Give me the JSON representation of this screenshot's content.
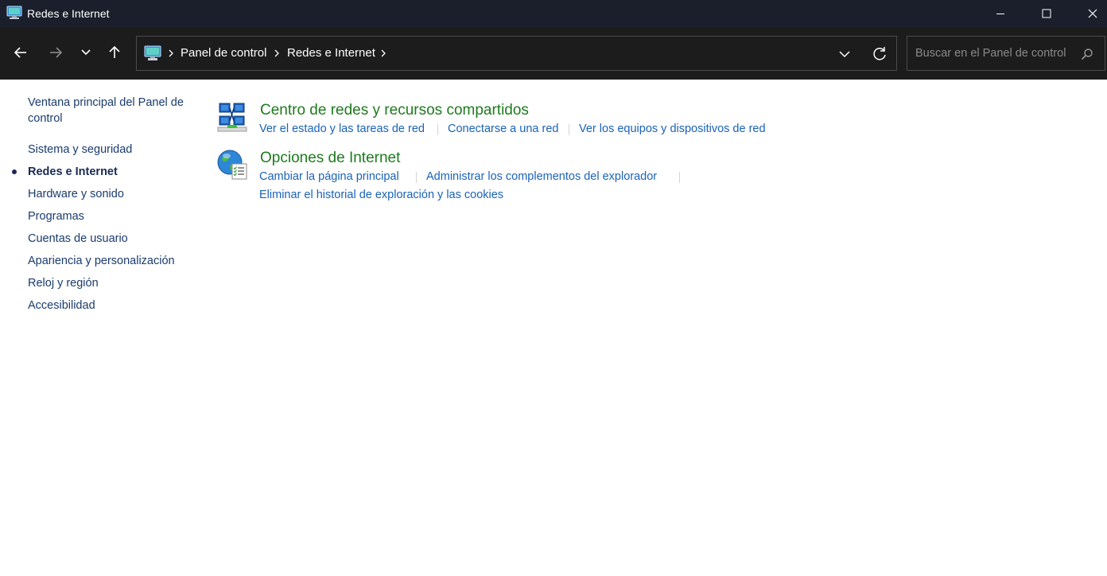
{
  "window": {
    "title": "Redes e Internet",
    "icons": [
      "control-panel-icon",
      "minimize-icon",
      "maximize-icon",
      "close-icon"
    ]
  },
  "navigation": {
    "icons": [
      "back-arrow-icon",
      "forward-arrow-icon",
      "chevron-down-icon",
      "up-arrow-icon"
    ]
  },
  "address": {
    "crumbs": [
      "Panel de control",
      "Redes e Internet"
    ],
    "icons": [
      "control-panel-icon",
      "chevron-right-icon",
      "chevron-down-icon",
      "refresh-icon"
    ]
  },
  "search": {
    "placeholder": "Buscar en el Panel de control",
    "icon": "search-icon"
  },
  "sidebar": {
    "home_link": "Ventana principal del Panel de control",
    "items": [
      {
        "label": "Sistema y seguridad",
        "active": false
      },
      {
        "label": "Redes e Internet",
        "active": true
      },
      {
        "label": "Hardware y sonido",
        "active": false
      },
      {
        "label": "Programas",
        "active": false
      },
      {
        "label": "Cuentas de usuario",
        "active": false
      },
      {
        "label": "Apariencia y personalización",
        "active": false
      },
      {
        "label": "Reloj y región",
        "active": false
      },
      {
        "label": "Accesibilidad",
        "active": false
      }
    ]
  },
  "categories": [
    {
      "title": "Centro de redes y recursos compartidos",
      "icon": "network-center-icon",
      "links": [
        "Ver el estado y las tareas de red",
        "Conectarse a una red",
        "Ver los equipos y dispositivos de red"
      ]
    },
    {
      "title": "Opciones de Internet",
      "icon": "internet-options-icon",
      "links": [
        "Cambiar la página principal",
        "Administrar los complementos del explorador",
        "Eliminar el historial de exploración y las cookies"
      ]
    }
  ],
  "colors": {
    "titlebar": "#1a1f2b",
    "navbar": "#1c1c1c",
    "category_title": "#1e7a1e",
    "task_link": "#1a62b8",
    "sidebar_link": "#1a3b6e"
  }
}
